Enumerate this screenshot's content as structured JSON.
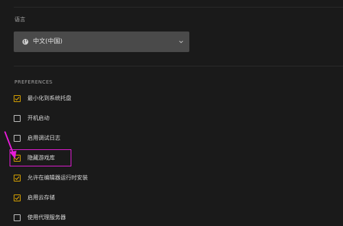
{
  "language": {
    "section_label": "语言",
    "selected_value": "中文(中国)",
    "icon": "globe-icon"
  },
  "preferences": {
    "section_label": "PREFERENCES",
    "items": [
      {
        "label": "最小化到系统托盘",
        "checked": true
      },
      {
        "label": "开机启动",
        "checked": false
      },
      {
        "label": "启用调试日志",
        "checked": false
      },
      {
        "label": "隐藏游戏库",
        "checked": true
      },
      {
        "label": "允许在编辑器运行时安装",
        "checked": true
      },
      {
        "label": "启用云存储",
        "checked": true
      },
      {
        "label": "使用代理服务器",
        "checked": false
      }
    ]
  },
  "annotation": {
    "highlight_color": "#e61cd8",
    "highlighted_item": "隐藏游戏库"
  },
  "colors": {
    "background": "#1a1a1a",
    "select_background": "#4a4a4a",
    "checkbox_checked": "#e0a800"
  }
}
